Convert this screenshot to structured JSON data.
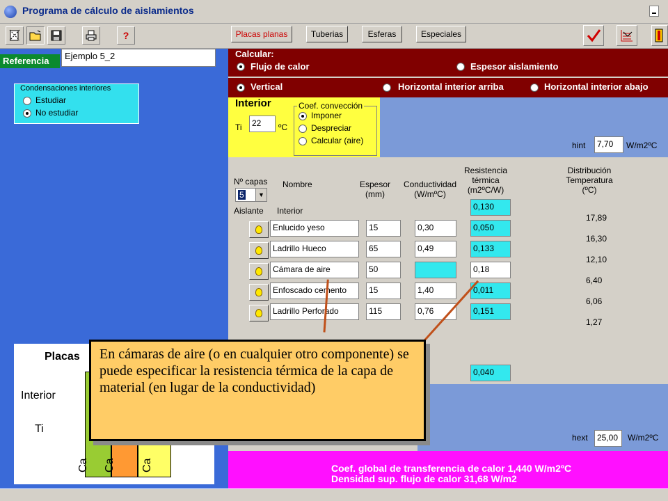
{
  "window": {
    "title": "Programa de cálculo de aislamientos"
  },
  "toolbar": {
    "buttons": [
      {
        "name": "new-icon"
      },
      {
        "name": "open-icon"
      },
      {
        "name": "save-icon"
      },
      {
        "name": "print-icon"
      },
      {
        "name": "help-icon"
      }
    ],
    "tabs": [
      "Placas planas",
      "Tuberias",
      "Esferas",
      "Especiales"
    ],
    "help_label": "?"
  },
  "left": {
    "referencia_label": "Referencia",
    "referencia_value": "Ejemplo 5_2",
    "condensaciones": {
      "title": "Condensaciones interiores",
      "options": [
        "Estudiar",
        "No estudiar"
      ],
      "selected": "No estudiar"
    },
    "preview": {
      "title": "Placas",
      "interior": "Interior",
      "ti": "Ti",
      "layers": [
        "Ca",
        "Ca",
        "Ca"
      ],
      "colors": [
        "#99cc33",
        "#ff9933",
        "#ffff66"
      ]
    }
  },
  "calcular": {
    "title": "Calcular:",
    "options": [
      "Flujo de calor",
      "Espesor aislamiento"
    ],
    "selected": "Flujo de calor"
  },
  "orientation": {
    "options": [
      "Vertical",
      "Horizontal interior arriba",
      "Horizontal interior abajo"
    ],
    "selected": "Vertical"
  },
  "interior": {
    "title": "Interior",
    "ti_label": "Ti",
    "ti_value": "22",
    "ti_unit": "ºC",
    "conveccion": {
      "title": "Coef. convección",
      "options": [
        "Imponer",
        "Despreciar",
        "Calcular (aire)"
      ],
      "selected": "Imponer"
    }
  },
  "hint": {
    "label": "hint",
    "value": "7,70",
    "unit": "W/m2ºC"
  },
  "hext": {
    "label": "hext",
    "value": "25,00",
    "unit": "W/m2ºC"
  },
  "layers_table": {
    "ncapas_label": "Nº capas",
    "ncapas_value": "5",
    "aislante_label": "Aislante",
    "headers": {
      "nombre": "Nombre",
      "espesor": "Espesor\n(mm)",
      "conductividad": "Conductividad\n(W/mºC)",
      "resistencia": "Resistencia\ntérmica\n(m2ºC/W)",
      "distribucion": "Distribución\nTemperatura\n(ºC)"
    },
    "interior_row": {
      "name": "Interior",
      "resistencia": "0,130",
      "temp": "17,89"
    },
    "rows": [
      {
        "name": "Enlucido yeso",
        "espesor": "15",
        "conductividad": "0,30",
        "resistencia": "0,050",
        "temp": "16,30"
      },
      {
        "name": "Ladrillo Hueco",
        "espesor": "65",
        "conductividad": "0,49",
        "resistencia": "0,133",
        "temp": "12,10"
      },
      {
        "name": "Cámara de aire",
        "espesor": "50",
        "conductividad": "",
        "resistencia": "0,18",
        "temp": "6,40"
      },
      {
        "name": "Enfoscado cemento",
        "espesor": "15",
        "conductividad": "1,40",
        "resistencia": "0,011",
        "temp": "6,06"
      },
      {
        "name": "Ladrillo Perforado",
        "espesor": "115",
        "conductividad": "0,76",
        "resistencia": "0,151",
        "temp": "1,27"
      }
    ],
    "exterior_resistencia": "0,040"
  },
  "results": {
    "line1": "Coef. global de transferencia de calor 1,440 W/m2ºC",
    "line2": "Densidad sup. flujo de calor 31,68 W/m2"
  },
  "callout": {
    "text": "En cámaras de aire (o en cualquier otro componente) se puede especificar la resistencia térmica de la capa de material (en lugar de la conductividad)"
  }
}
